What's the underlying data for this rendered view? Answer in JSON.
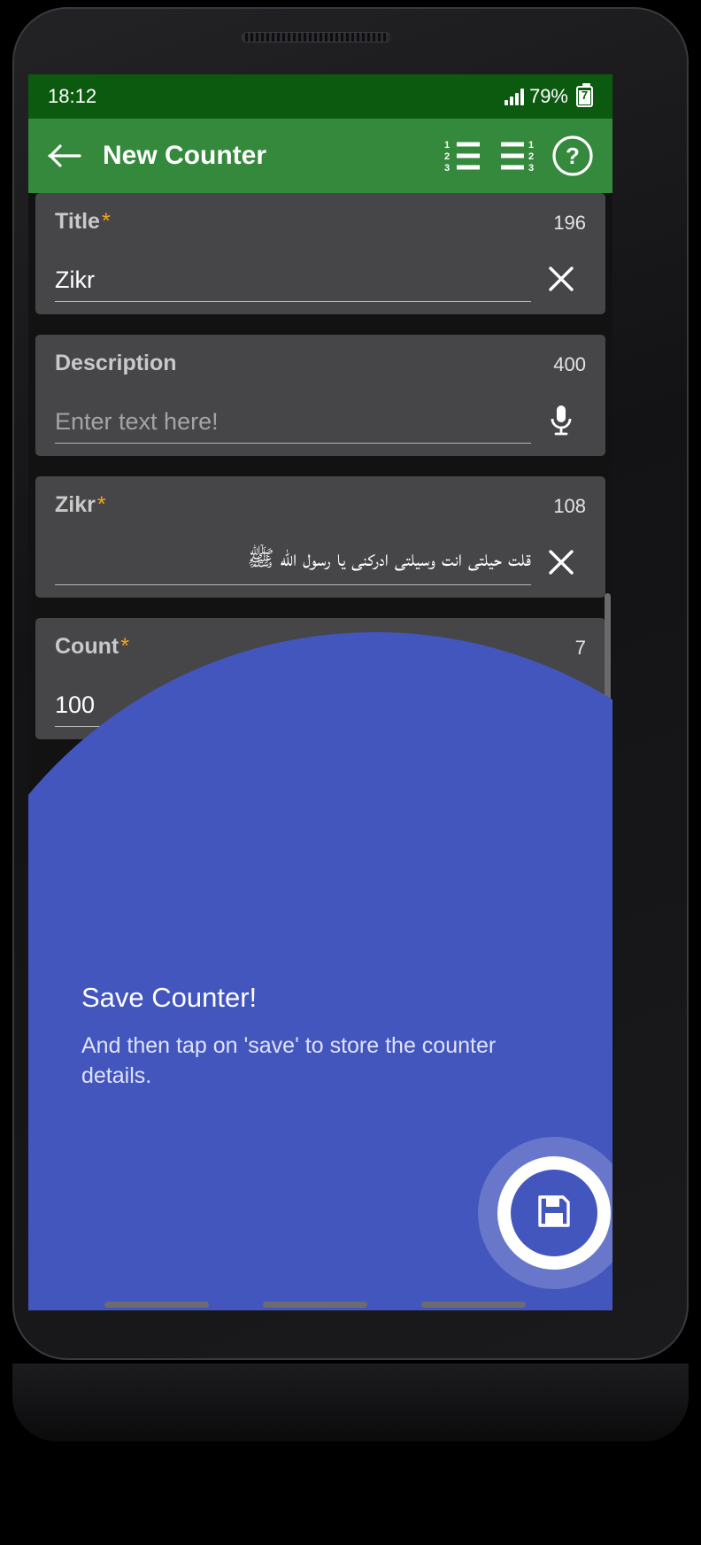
{
  "status_bar": {
    "time": "18:12",
    "battery_percent": "79%",
    "battery_level_text": "7",
    "signal_icon": "signal-bars-icon",
    "battery_icon": "battery-icon",
    "background_color": "#0c5a10"
  },
  "app_bar": {
    "title": "New Counter",
    "background_color": "#34893c",
    "back_icon": "back-arrow-icon",
    "actions": [
      {
        "name": "list-numbers-left-icon",
        "label": "Numbered list left"
      },
      {
        "name": "list-numbers-right-icon",
        "label": "Numbered list right"
      },
      {
        "name": "help-circle-icon",
        "label": "Help"
      }
    ]
  },
  "form": {
    "fields": [
      {
        "label": "Title",
        "required": true,
        "char_count": "196",
        "value": "Zikr",
        "placeholder": "",
        "action_icon": "clear-x-icon",
        "rtl": false
      },
      {
        "label": "Description",
        "required": false,
        "char_count": "400",
        "value": "",
        "placeholder": "Enter text here!",
        "action_icon": "microphone-icon",
        "rtl": false
      },
      {
        "label": "Zikr",
        "required": true,
        "char_count": "108",
        "value": "قلت حيلتى انت وسيلتى ادركنى يا رسول الله ﷺ",
        "placeholder": "",
        "action_icon": "clear-x-icon",
        "rtl": true
      },
      {
        "label": "Count",
        "required": true,
        "char_count": "7",
        "value": "100",
        "placeholder": "",
        "action_icon": "clear-x-icon",
        "rtl": false
      }
    ],
    "required_marker": "*",
    "required_color": "#f6a21d",
    "card_color": "#464649"
  },
  "coach_mark": {
    "title": "Save Counter!",
    "body": "And then tap on 'save' to store the counter details.",
    "overlay_color": "#4356bd",
    "fab_icon": "save-floppy-icon",
    "fab_color": "#4356bd"
  }
}
